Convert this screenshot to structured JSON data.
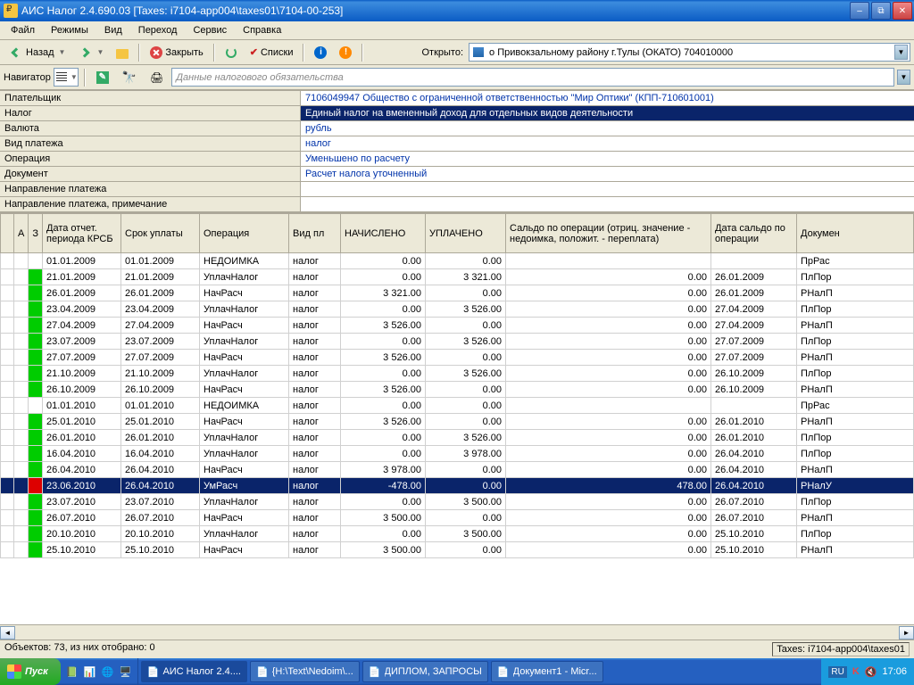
{
  "window": {
    "title": "АИС Налог 2.4.690.03 [Taxes: i7104-app004\\taxes01\\7104-00-253]"
  },
  "menubar": [
    "Файл",
    "Режимы",
    "Вид",
    "Переход",
    "Сервис",
    "Справка"
  ],
  "toolbar": {
    "back": "Назад",
    "close": "Закрыть",
    "lists": "Списки",
    "opened_label": "Открыто:",
    "opened_value": "о Привокзальному району г.Тулы (ОКАТО) 704010000"
  },
  "navigator": {
    "label": "Навигатор",
    "breadcrumb": "Данные налогового обязательства"
  },
  "form": {
    "rows": [
      {
        "label": "Плательщик",
        "value": "7106049947   Общество с ограниченной ответственностью \"Мир Оптики\" (КПП-710601001)",
        "hl": false
      },
      {
        "label": "Налог",
        "value": "Единый налог на вмененный доход для отдельных видов деятельности",
        "hl": true
      },
      {
        "label": "Валюта",
        "value": "рубль",
        "hl": false
      },
      {
        "label": "Вид платежа",
        "value": "налог",
        "hl": false
      },
      {
        "label": "Операция",
        "value": "Уменьшено по расчету",
        "hl": false
      },
      {
        "label": "Документ",
        "value": "Расчет налога уточненный",
        "hl": false
      },
      {
        "label": "Направление платежа",
        "value": "",
        "hl": false
      },
      {
        "label": "Направление платежа, примечание",
        "value": "",
        "hl": false
      }
    ]
  },
  "grid": {
    "headers": {
      "a": "А",
      "z": "З",
      "period": "Дата отчет. периода КРСБ",
      "due": "Срок уплаты",
      "op": "Операция",
      "pay_type": "Вид пл",
      "accrued": "НАЧИСЛЕНО",
      "paid": "УПЛАЧЕНО",
      "balance": "Сальдо по операции (отриц. значение - недоимка, положит. - переплата)",
      "balance_date": "Дата сальдо по операции",
      "doc": "Докумен"
    },
    "rows": [
      {
        "m": "",
        "period": "01.01.2009",
        "due": "01.01.2009",
        "op": "НЕДОИМКА",
        "pt": "налог",
        "acc": "0.00",
        "paid": "0.00",
        "bal": "",
        "bdate": "",
        "doc": "ПрРас",
        "sel": false
      },
      {
        "m": "g",
        "period": "21.01.2009",
        "due": "21.01.2009",
        "op": "УплачНалог",
        "pt": "налог",
        "acc": "0.00",
        "paid": "3 321.00",
        "bal": "0.00",
        "bdate": "26.01.2009",
        "doc": "ПлПор",
        "sel": false
      },
      {
        "m": "g",
        "period": "26.01.2009",
        "due": "26.01.2009",
        "op": "НачРасч",
        "pt": "налог",
        "acc": "3 321.00",
        "paid": "0.00",
        "bal": "0.00",
        "bdate": "26.01.2009",
        "doc": "РНалП",
        "sel": false
      },
      {
        "m": "g",
        "period": "23.04.2009",
        "due": "23.04.2009",
        "op": "УплачНалог",
        "pt": "налог",
        "acc": "0.00",
        "paid": "3 526.00",
        "bal": "0.00",
        "bdate": "27.04.2009",
        "doc": "ПлПор",
        "sel": false
      },
      {
        "m": "g",
        "period": "27.04.2009",
        "due": "27.04.2009",
        "op": "НачРасч",
        "pt": "налог",
        "acc": "3 526.00",
        "paid": "0.00",
        "bal": "0.00",
        "bdate": "27.04.2009",
        "doc": "РНалП",
        "sel": false
      },
      {
        "m": "g",
        "period": "23.07.2009",
        "due": "23.07.2009",
        "op": "УплачНалог",
        "pt": "налог",
        "acc": "0.00",
        "paid": "3 526.00",
        "bal": "0.00",
        "bdate": "27.07.2009",
        "doc": "ПлПор",
        "sel": false
      },
      {
        "m": "g",
        "period": "27.07.2009",
        "due": "27.07.2009",
        "op": "НачРасч",
        "pt": "налог",
        "acc": "3 526.00",
        "paid": "0.00",
        "bal": "0.00",
        "bdate": "27.07.2009",
        "doc": "РНалП",
        "sel": false
      },
      {
        "m": "g",
        "period": "21.10.2009",
        "due": "21.10.2009",
        "op": "УплачНалог",
        "pt": "налог",
        "acc": "0.00",
        "paid": "3 526.00",
        "bal": "0.00",
        "bdate": "26.10.2009",
        "doc": "ПлПор",
        "sel": false
      },
      {
        "m": "g",
        "period": "26.10.2009",
        "due": "26.10.2009",
        "op": "НачРасч",
        "pt": "налог",
        "acc": "3 526.00",
        "paid": "0.00",
        "bal": "0.00",
        "bdate": "26.10.2009",
        "doc": "РНалП",
        "sel": false
      },
      {
        "m": "",
        "period": "01.01.2010",
        "due": "01.01.2010",
        "op": "НЕДОИМКА",
        "pt": "налог",
        "acc": "0.00",
        "paid": "0.00",
        "bal": "",
        "bdate": "",
        "doc": "ПрРас",
        "sel": false
      },
      {
        "m": "g",
        "period": "25.01.2010",
        "due": "25.01.2010",
        "op": "НачРасч",
        "pt": "налог",
        "acc": "3 526.00",
        "paid": "0.00",
        "bal": "0.00",
        "bdate": "26.01.2010",
        "doc": "РНалП",
        "sel": false
      },
      {
        "m": "g",
        "period": "26.01.2010",
        "due": "26.01.2010",
        "op": "УплачНалог",
        "pt": "налог",
        "acc": "0.00",
        "paid": "3 526.00",
        "bal": "0.00",
        "bdate": "26.01.2010",
        "doc": "ПлПор",
        "sel": false
      },
      {
        "m": "g",
        "period": "16.04.2010",
        "due": "16.04.2010",
        "op": "УплачНалог",
        "pt": "налог",
        "acc": "0.00",
        "paid": "3 978.00",
        "bal": "0.00",
        "bdate": "26.04.2010",
        "doc": "ПлПор",
        "sel": false
      },
      {
        "m": "g",
        "period": "26.04.2010",
        "due": "26.04.2010",
        "op": "НачРасч",
        "pt": "налог",
        "acc": "3 978.00",
        "paid": "0.00",
        "bal": "0.00",
        "bdate": "26.04.2010",
        "doc": "РНалП",
        "sel": false
      },
      {
        "m": "r",
        "period": "23.06.2010",
        "due": "26.04.2010",
        "op": "УмРасч",
        "pt": "налог",
        "acc": "-478.00",
        "paid": "0.00",
        "bal": "478.00",
        "bdate": "26.04.2010",
        "doc": "РНалУ",
        "sel": true
      },
      {
        "m": "g",
        "period": "23.07.2010",
        "due": "23.07.2010",
        "op": "УплачНалог",
        "pt": "налог",
        "acc": "0.00",
        "paid": "3 500.00",
        "bal": "0.00",
        "bdate": "26.07.2010",
        "doc": "ПлПор",
        "sel": false
      },
      {
        "m": "g",
        "period": "26.07.2010",
        "due": "26.07.2010",
        "op": "НачРасч",
        "pt": "налог",
        "acc": "3 500.00",
        "paid": "0.00",
        "bal": "0.00",
        "bdate": "26.07.2010",
        "doc": "РНалП",
        "sel": false
      },
      {
        "m": "g",
        "period": "20.10.2010",
        "due": "20.10.2010",
        "op": "УплачНалог",
        "pt": "налог",
        "acc": "0.00",
        "paid": "3 500.00",
        "bal": "0.00",
        "bdate": "25.10.2010",
        "doc": "ПлПор",
        "sel": false
      },
      {
        "m": "g",
        "period": "25.10.2010",
        "due": "25.10.2010",
        "op": "НачРасч",
        "pt": "налог",
        "acc": "3 500.00",
        "paid": "0.00",
        "bal": "0.00",
        "bdate": "25.10.2010",
        "doc": "РНалП",
        "sel": false
      }
    ]
  },
  "statusbar": {
    "left": "Объектов: 73, из них отобрано: 0",
    "right": "Taxes: i7104-app004\\taxes01"
  },
  "taskbar": {
    "start": "Пуск",
    "items": [
      {
        "label": "АИС Налог 2.4....",
        "active": true
      },
      {
        "label": "{H:\\Text\\Nedoim\\...",
        "active": false
      },
      {
        "label": "ДИПЛОМ, ЗАПРОСЫ",
        "active": false
      },
      {
        "label": "Документ1 - Micr...",
        "active": false
      }
    ],
    "lang": "RU",
    "clock": "17:06"
  }
}
